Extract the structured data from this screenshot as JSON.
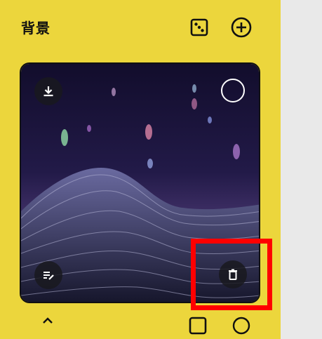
{
  "panel": {
    "title": "背景",
    "header_icons": [
      "dice-icon",
      "plus-circle-icon"
    ]
  },
  "card": {
    "image_alt": "",
    "overlay_icons": [
      "download-icon",
      "select-circle",
      "edit-note-icon",
      "trash-icon"
    ]
  },
  "colors": {
    "panel_bg": "#ecd63c",
    "highlight": "#ff0000",
    "overlay_dark": "#19191e"
  }
}
